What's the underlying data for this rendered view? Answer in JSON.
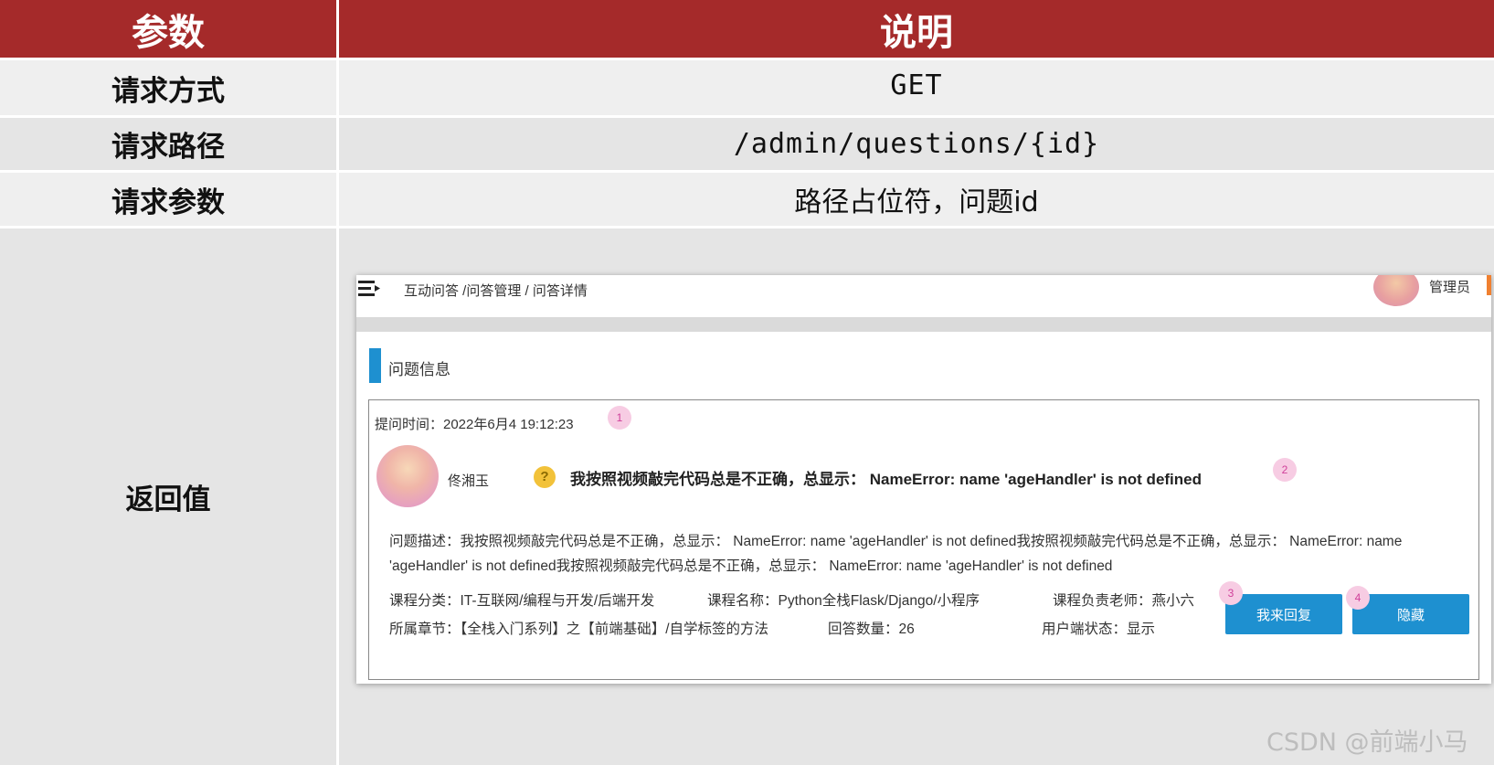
{
  "table": {
    "header": {
      "col1": "参数",
      "col2": "说明"
    },
    "rows": [
      {
        "param": "请求方式",
        "value": "GET"
      },
      {
        "param": "请求路径",
        "value": "/admin/questions/{id}"
      },
      {
        "param": "请求参数",
        "value": "路径占位符，问题id"
      },
      {
        "param": "返回值",
        "value": ""
      }
    ]
  },
  "screenshot": {
    "breadcrumb": "互动问答 /问答管理 / 问答详情",
    "admin_label": "管理员",
    "section_title": "问题信息",
    "ask_time": "提问时间：2022年6月4 19:12:23",
    "badges": [
      "1",
      "2",
      "3",
      "4"
    ],
    "user_name": "佟湘玉",
    "question_title": "我按照视频敲完代码总是不正确，总显示： NameError: name 'ageHandler' is not defined",
    "description": "问题描述：我按照视频敲完代码总是不正确，总显示： NameError: name 'ageHandler' is not defined我按照视频敲完代码总是不正确，总显示： NameError: name 'ageHandler' is not defined我按照视频敲完代码总是不正确，总显示： NameError: name 'ageHandler' is not defined",
    "course_category": "课程分类：IT-互联网/编程与开发/后端开发",
    "course_name": "课程名称：Python全栈Flask/Django/小程序",
    "teacher": "课程负责老师：燕小六",
    "chapter": "所属章节：【全栈入门系列】之【前端基础】/自学标签的方法",
    "answer_count": "回答数量：26",
    "user_status": "用户端状态：显示",
    "reply_button": "我来回复",
    "hide_button": "隐藏"
  },
  "watermark": "CSDN @前端小马",
  "colors": {
    "header_red": "#a52a2a",
    "button_blue": "#1e90d0",
    "badge_pink": "#f7cce3"
  }
}
